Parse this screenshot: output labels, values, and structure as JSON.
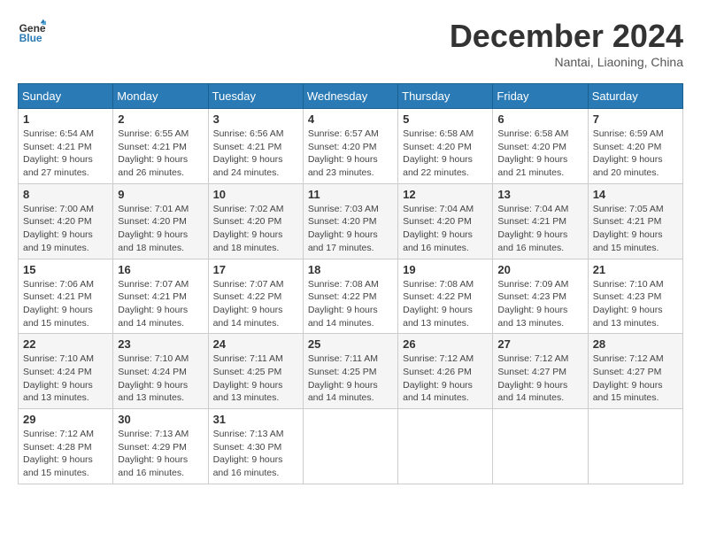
{
  "logo": {
    "line1": "General",
    "line2": "Blue"
  },
  "title": "December 2024",
  "subtitle": "Nantai, Liaoning, China",
  "weekdays": [
    "Sunday",
    "Monday",
    "Tuesday",
    "Wednesday",
    "Thursday",
    "Friday",
    "Saturday"
  ],
  "weeks": [
    [
      {
        "day": "1",
        "info": "Sunrise: 6:54 AM\nSunset: 4:21 PM\nDaylight: 9 hours and 27 minutes."
      },
      {
        "day": "2",
        "info": "Sunrise: 6:55 AM\nSunset: 4:21 PM\nDaylight: 9 hours and 26 minutes."
      },
      {
        "day": "3",
        "info": "Sunrise: 6:56 AM\nSunset: 4:21 PM\nDaylight: 9 hours and 24 minutes."
      },
      {
        "day": "4",
        "info": "Sunrise: 6:57 AM\nSunset: 4:20 PM\nDaylight: 9 hours and 23 minutes."
      },
      {
        "day": "5",
        "info": "Sunrise: 6:58 AM\nSunset: 4:20 PM\nDaylight: 9 hours and 22 minutes."
      },
      {
        "day": "6",
        "info": "Sunrise: 6:58 AM\nSunset: 4:20 PM\nDaylight: 9 hours and 21 minutes."
      },
      {
        "day": "7",
        "info": "Sunrise: 6:59 AM\nSunset: 4:20 PM\nDaylight: 9 hours and 20 minutes."
      }
    ],
    [
      {
        "day": "8",
        "info": "Sunrise: 7:00 AM\nSunset: 4:20 PM\nDaylight: 9 hours and 19 minutes."
      },
      {
        "day": "9",
        "info": "Sunrise: 7:01 AM\nSunset: 4:20 PM\nDaylight: 9 hours and 18 minutes."
      },
      {
        "day": "10",
        "info": "Sunrise: 7:02 AM\nSunset: 4:20 PM\nDaylight: 9 hours and 18 minutes."
      },
      {
        "day": "11",
        "info": "Sunrise: 7:03 AM\nSunset: 4:20 PM\nDaylight: 9 hours and 17 minutes."
      },
      {
        "day": "12",
        "info": "Sunrise: 7:04 AM\nSunset: 4:20 PM\nDaylight: 9 hours and 16 minutes."
      },
      {
        "day": "13",
        "info": "Sunrise: 7:04 AM\nSunset: 4:21 PM\nDaylight: 9 hours and 16 minutes."
      },
      {
        "day": "14",
        "info": "Sunrise: 7:05 AM\nSunset: 4:21 PM\nDaylight: 9 hours and 15 minutes."
      }
    ],
    [
      {
        "day": "15",
        "info": "Sunrise: 7:06 AM\nSunset: 4:21 PM\nDaylight: 9 hours and 15 minutes."
      },
      {
        "day": "16",
        "info": "Sunrise: 7:07 AM\nSunset: 4:21 PM\nDaylight: 9 hours and 14 minutes."
      },
      {
        "day": "17",
        "info": "Sunrise: 7:07 AM\nSunset: 4:22 PM\nDaylight: 9 hours and 14 minutes."
      },
      {
        "day": "18",
        "info": "Sunrise: 7:08 AM\nSunset: 4:22 PM\nDaylight: 9 hours and 14 minutes."
      },
      {
        "day": "19",
        "info": "Sunrise: 7:08 AM\nSunset: 4:22 PM\nDaylight: 9 hours and 13 minutes."
      },
      {
        "day": "20",
        "info": "Sunrise: 7:09 AM\nSunset: 4:23 PM\nDaylight: 9 hours and 13 minutes."
      },
      {
        "day": "21",
        "info": "Sunrise: 7:10 AM\nSunset: 4:23 PM\nDaylight: 9 hours and 13 minutes."
      }
    ],
    [
      {
        "day": "22",
        "info": "Sunrise: 7:10 AM\nSunset: 4:24 PM\nDaylight: 9 hours and 13 minutes."
      },
      {
        "day": "23",
        "info": "Sunrise: 7:10 AM\nSunset: 4:24 PM\nDaylight: 9 hours and 13 minutes."
      },
      {
        "day": "24",
        "info": "Sunrise: 7:11 AM\nSunset: 4:25 PM\nDaylight: 9 hours and 13 minutes."
      },
      {
        "day": "25",
        "info": "Sunrise: 7:11 AM\nSunset: 4:25 PM\nDaylight: 9 hours and 14 minutes."
      },
      {
        "day": "26",
        "info": "Sunrise: 7:12 AM\nSunset: 4:26 PM\nDaylight: 9 hours and 14 minutes."
      },
      {
        "day": "27",
        "info": "Sunrise: 7:12 AM\nSunset: 4:27 PM\nDaylight: 9 hours and 14 minutes."
      },
      {
        "day": "28",
        "info": "Sunrise: 7:12 AM\nSunset: 4:27 PM\nDaylight: 9 hours and 15 minutes."
      }
    ],
    [
      {
        "day": "29",
        "info": "Sunrise: 7:12 AM\nSunset: 4:28 PM\nDaylight: 9 hours and 15 minutes."
      },
      {
        "day": "30",
        "info": "Sunrise: 7:13 AM\nSunset: 4:29 PM\nDaylight: 9 hours and 16 minutes."
      },
      {
        "day": "31",
        "info": "Sunrise: 7:13 AM\nSunset: 4:30 PM\nDaylight: 9 hours and 16 minutes."
      },
      null,
      null,
      null,
      null
    ]
  ]
}
